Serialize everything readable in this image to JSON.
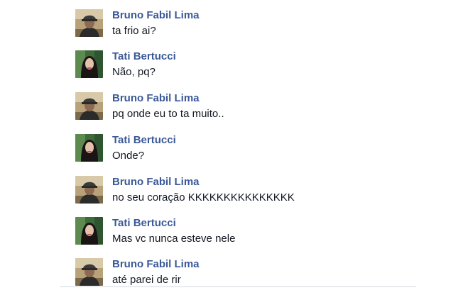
{
  "conversation": {
    "messages": [
      {
        "sender": "Bruno Fabil Lima",
        "text": "ta frio ai?",
        "avatar": "bruno-avatar-icon"
      },
      {
        "sender": "Tati Bertucci",
        "text": "Não, pq?",
        "avatar": "tati-avatar-icon"
      },
      {
        "sender": "Bruno Fabil Lima",
        "text": "pq onde eu to ta muito..",
        "avatar": "bruno-avatar-icon"
      },
      {
        "sender": "Tati Bertucci",
        "text": "Onde?",
        "avatar": "tati-avatar-icon"
      },
      {
        "sender": "Bruno Fabil Lima",
        "text": "no seu coração KKKKKKKKKKKKKKK",
        "avatar": "bruno-avatar-icon"
      },
      {
        "sender": "Tati Bertucci",
        "text": "Mas vc nunca esteve nele",
        "avatar": "tati-avatar-icon"
      },
      {
        "sender": "Bruno Fabil Lima",
        "text": "até parei de rir",
        "avatar": "bruno-avatar-icon"
      }
    ]
  },
  "colors": {
    "sender_name": "#3b5998",
    "message_text": "#141823",
    "background": "#ffffff"
  }
}
